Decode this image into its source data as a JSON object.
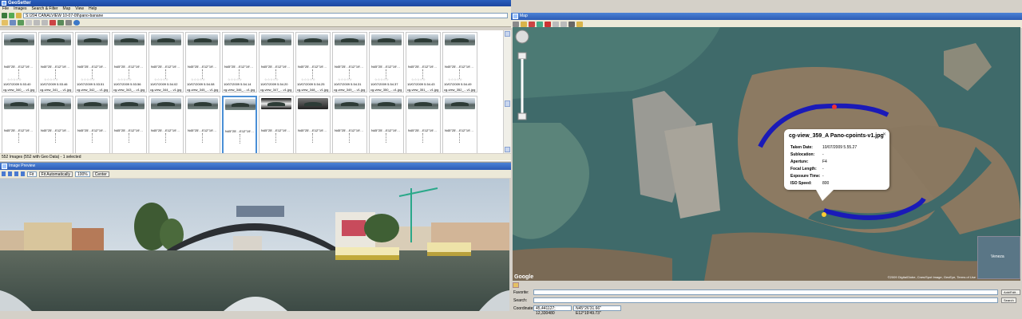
{
  "app": {
    "title": "GeoSetter"
  },
  "menu": [
    "File",
    "Images",
    "Search & Filter",
    "Map",
    "View",
    "Help"
  ],
  "address": {
    "path": "S:\\204 CANALVIEW 10-07-09\\pano-banane"
  },
  "thumbnails": {
    "row1": [
      {
        "loc": "N45°25'…E12°19'…",
        "date": "10/07/2009 5.53.40",
        "file": "cg-view_340_…v1.jpg"
      },
      {
        "loc": "N45°25'…E12°19'…",
        "date": "10/07/2009 5.53.46",
        "file": "cg-view_341_…v1.jpg"
      },
      {
        "loc": "N45°25'…E12°19'…",
        "date": "10/07/2009 5.53.51",
        "file": "cg-view_342_…v1.jpg"
      },
      {
        "loc": "N45°25'…E12°19'…",
        "date": "10/07/2009 5.53.56",
        "file": "cg-view_343_…v1.jpg"
      },
      {
        "loc": "N45°25'…E12°19'…",
        "date": "10/07/2009 5.54.02",
        "file": "cg-view_344_…v1.jpg"
      },
      {
        "loc": "N45°25'…E12°19'…",
        "date": "10/07/2009 5.54.08",
        "file": "cg-view_345_…v1.jpg"
      },
      {
        "loc": "N45°25'…E12°19'…",
        "date": "10/07/2009 5.54.14",
        "file": "cg-view_346_…v1.jpg"
      },
      {
        "loc": "N45°25'…E12°19'…",
        "date": "10/07/2009 5.54.20",
        "file": "cg-view_347_…v1.jpg"
      },
      {
        "loc": "N45°25'…E12°19'…",
        "date": "10/07/2009 5.54.25",
        "file": "cg-view_348_…v1.jpg"
      },
      {
        "loc": "N45°25'…E12°19'…",
        "date": "10/07/2009 5.54.31",
        "file": "cg-view_349_…v1.jpg"
      },
      {
        "loc": "N45°25'…E12°19'…",
        "date": "10/07/2009 5.54.37",
        "file": "cg-view_350_…v1.jpg"
      },
      {
        "loc": "N45°25'…E12°19'…",
        "date": "10/07/2009 5.54.43",
        "file": "cg-view_351_…v1.jpg"
      },
      {
        "loc": "N45°25'…E12°19'…",
        "date": "10/07/2009 5.54.49",
        "file": "cg-view_352_…v1.jpg"
      }
    ],
    "row2_count": 13,
    "selected_index": 6,
    "stars": "☆☆☆☆☆"
  },
  "status": {
    "text": "552 Images (552 with Geo Data) - 1 selected"
  },
  "preview": {
    "title": "Image Preview",
    "fit": "Fit",
    "fit_auto": "Fit Automatically",
    "zoom": "100%",
    "center": "Center"
  },
  "map": {
    "title": "Map",
    "popup": {
      "title": "cg-view_359_A Pano-cpoints-v1.jpg",
      "rows": [
        {
          "label": "Taken Date:",
          "value": "10/07/2009 5.55.27"
        },
        {
          "label": "Sublocation:",
          "value": "-"
        },
        {
          "label": "Aperture:",
          "value": "F4"
        },
        {
          "label": "Focal Length:",
          "value": "-"
        },
        {
          "label": "Exposure Time:",
          "value": "-"
        },
        {
          "label": "ISO Speed:",
          "value": "800"
        }
      ]
    },
    "copyright": "©2009 DigitalGlobe, Cnes/Spot Image, GeoEye, Terms of Use",
    "google": "Google",
    "inset_label": "Veneza"
  },
  "form": {
    "favorite_label": "Favorite:",
    "search_label": "Search:",
    "coords_label": "Coordinates:",
    "coords_value": "45,441127; 12,330480",
    "coords_dms": "N45°26'31.66\" E12°19'49.73\"",
    "add_edit": "Add/Edit...",
    "search_btn": "Search"
  },
  "colors": {
    "track": "#1a1ab8",
    "title_bar": "#2d5cb5"
  }
}
